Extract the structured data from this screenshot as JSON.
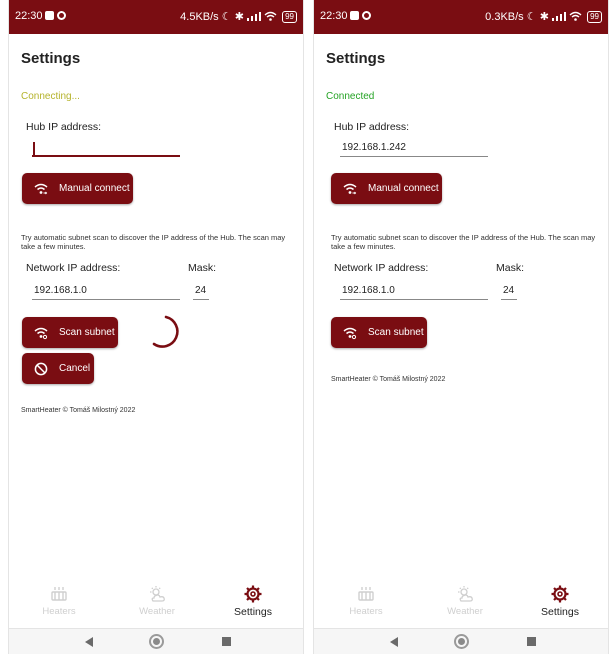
{
  "colors": {
    "accent": "#7a0d12",
    "connecting": "#b5b32c",
    "connected": "#25a325",
    "disabled": "#cfcfcf"
  },
  "screens": [
    {
      "status_bar": {
        "time": "22:30",
        "speed": "4.5KB/s",
        "battery": "99"
      },
      "title": "Settings",
      "connection_status": "Connecting...",
      "hub_label": "Hub IP address:",
      "hub_value": "",
      "manual_connect_label": "Manual connect",
      "help_text": "Try automatic subnet scan to discover the IP address of the Hub. The scan may take a few minutes.",
      "network_label": "Network IP address:",
      "mask_label": "Mask:",
      "network_value": "192.168.1.0",
      "mask_value": "24",
      "scan_label": "Scan subnet",
      "cancel_label": "Cancel",
      "credit": "SmartHeater © Tomáš Milostný 2022",
      "nav": [
        {
          "label": "Heaters",
          "icon": "heater-icon",
          "state": "disabled"
        },
        {
          "label": "Weather",
          "icon": "weather-icon",
          "state": "disabled"
        },
        {
          "label": "Settings",
          "icon": "gear-icon",
          "state": "active"
        }
      ]
    },
    {
      "status_bar": {
        "time": "22:30",
        "speed": "0.3KB/s",
        "battery": "99"
      },
      "title": "Settings",
      "connection_status": "Connected",
      "hub_label": "Hub IP address:",
      "hub_value": "192.168.1.242",
      "manual_connect_label": "Manual connect",
      "help_text": "Try automatic subnet scan to discover the IP address of the Hub. The scan may take a few minutes.",
      "network_label": "Network IP address:",
      "mask_label": "Mask:",
      "network_value": "192.168.1.0",
      "mask_value": "24",
      "scan_label": "Scan subnet",
      "credit": "SmartHeater © Tomáš Milostný 2022",
      "nav": [
        {
          "label": "Heaters",
          "icon": "heater-icon",
          "state": "disabled"
        },
        {
          "label": "Weather",
          "icon": "weather-icon",
          "state": "disabled"
        },
        {
          "label": "Settings",
          "icon": "gear-icon",
          "state": "active"
        }
      ]
    }
  ]
}
